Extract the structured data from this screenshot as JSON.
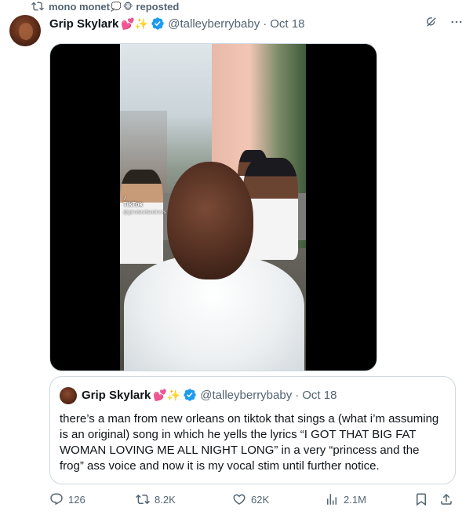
{
  "repost": {
    "user": "mono monet",
    "label": "reposted"
  },
  "post": {
    "name": "Grip Skylark",
    "emojis": "💕✨",
    "handle": "@talleyberrybaby",
    "separator": "·",
    "date": "Oct 18"
  },
  "video": {
    "watermark_brand": "TikTok",
    "watermark_handle": "@glendavidandrews"
  },
  "quote": {
    "name": "Grip Skylark",
    "emojis": "💕✨",
    "handle": "@talleyberrybaby",
    "separator": "·",
    "date": "Oct 18",
    "text": "there’s a man from new orleans on tiktok that sings a (what i’m assuming is an original) song in which he yells the lyrics “I GOT THAT BIG FAT WOMAN LOVING ME ALL NIGHT LONG” in a very “princess and the frog” ass voice and now it is my vocal stim until further notice."
  },
  "actions": {
    "replies": "126",
    "reposts": "8.2K",
    "likes": "62K",
    "views": "2.1M"
  },
  "colors": {
    "verified": "#1d9bf0",
    "muted": "#536471",
    "border": "#cfd9de"
  }
}
